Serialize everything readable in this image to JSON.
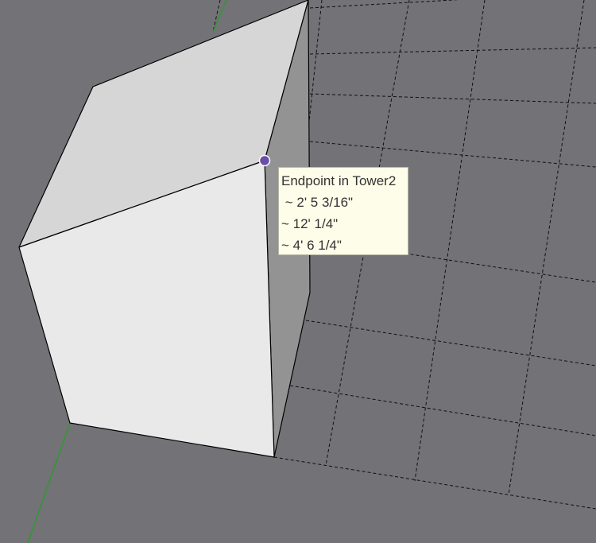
{
  "tooltip": {
    "title": "Endpoint in Tower2",
    "coordinates": [
      " ~ 2' 5 3/16\"",
      "~ 12' 1/4\"",
      "~ 4' 6 1/4\""
    ]
  },
  "colors": {
    "background": "#737277",
    "grid": "#101010",
    "green_axis": "#2e9a2e",
    "top_face": "#d6d6d6",
    "front_face": "#e9e9e9",
    "side_face": "#939393",
    "endpoint_marker": "#6a4fa8",
    "tooltip_bg": "#fdfde9"
  }
}
